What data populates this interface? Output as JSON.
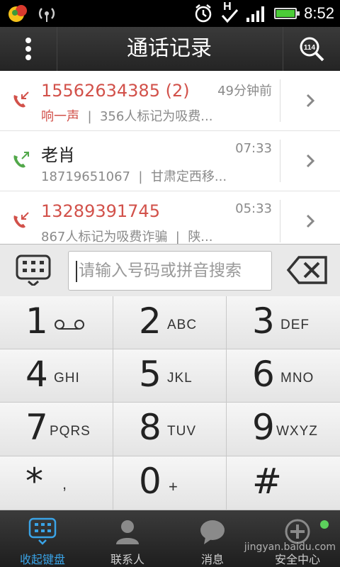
{
  "status_bar": {
    "time": "8:52",
    "network_letter": "H"
  },
  "title_bar": {
    "title": "通话记录",
    "search_badge": "114"
  },
  "calls": [
    {
      "name": "15562634385 (2)",
      "type": "missed",
      "time": "49分钟前",
      "tag": "响一声",
      "detail": "356人标记为吸费..."
    },
    {
      "name": "老肖",
      "type": "outgoing",
      "time": "07:33",
      "number": "18719651067",
      "location": "甘肃定西移..."
    },
    {
      "name": "13289391745",
      "type": "missed",
      "time": "05:33",
      "detail": "867人标记为吸费诈骗",
      "location": "陕..."
    }
  ],
  "dial": {
    "placeholder": "请输入号码或拼音搜索"
  },
  "keypad": [
    {
      "digit": "1",
      "letters": ""
    },
    {
      "digit": "2",
      "letters": "ABC"
    },
    {
      "digit": "3",
      "letters": "DEF"
    },
    {
      "digit": "4",
      "letters": "GHI"
    },
    {
      "digit": "5",
      "letters": "JKL"
    },
    {
      "digit": "6",
      "letters": "MNO"
    },
    {
      "digit": "7",
      "letters": "PQRS"
    },
    {
      "digit": "8",
      "letters": "TUV"
    },
    {
      "digit": "9",
      "letters": "WXYZ"
    },
    {
      "digit": "*",
      "letters": ","
    },
    {
      "digit": "0",
      "letters": "+"
    },
    {
      "digit": "#",
      "letters": ""
    }
  ],
  "bottom_nav": [
    {
      "label": "收起键盘",
      "icon": "dialpad-icon",
      "active": true
    },
    {
      "label": "联系人",
      "icon": "contact-icon",
      "active": false
    },
    {
      "label": "消息",
      "icon": "message-icon",
      "active": false
    },
    {
      "label": "安全中心",
      "icon": "shield-plus-icon",
      "active": false
    }
  ],
  "watermark": "jingyan.baidu.com",
  "colors": {
    "missed": "#d2514a",
    "outgoing": "#52a84a",
    "active_tab": "#3aa3e6"
  }
}
